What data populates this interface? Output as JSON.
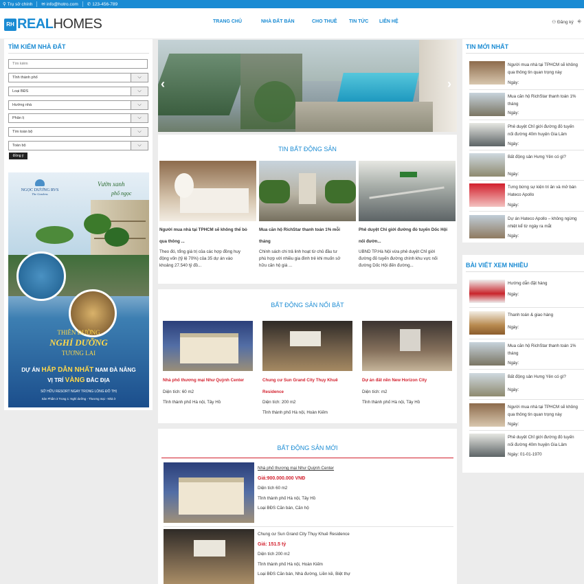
{
  "topbar": {
    "address": "Trụ sở chính",
    "email": "info@hotro.com",
    "phone": "123-456-789"
  },
  "header": {
    "logo_mark": "RH",
    "logo_word_1": "REAL",
    "logo_word_2": "HOMES",
    "nav": [
      "TRANG CHỦ",
      "NHÀ ĐẤT BÁN",
      "CHO THUÊ",
      "TIN TỨC",
      "LIÊN HỆ"
    ],
    "register": "Đăng ký"
  },
  "search": {
    "title": "TÌM KIẾM NHÀ ĐẤT",
    "placeholder": "Tìm kiếm",
    "selects": [
      "Tỉnh thành phố",
      "Loại BĐS",
      "Hướng nhà",
      "Phân lị",
      "Tìm toàn bộ",
      "Toàn bộ"
    ],
    "button": "Đồng ý"
  },
  "ad": {
    "brand": "NGỌC DƯƠNG RVS",
    "brand_sub": "The Gardens",
    "script": "Vườn xanh",
    "script_2": "phố ngọc",
    "line1": "THIÊN ĐƯỜNG",
    "line2": "NGHỈ DƯỠNG",
    "line3": "TƯƠNG LAI",
    "line4a": "DỰ ÁN",
    "line4b": "HẤP DẪN NHẤT",
    "line4c": "NAM ĐÀ NẴNG",
    "line5a": "VỊ TRÍ",
    "line5b": "VÀNG",
    "line5c": "ĐẮC ĐỊA",
    "line6": "SỞ HỮU RESORT NGAY TRONG LÒNG ĐÔ THỊ",
    "line7": "Sản Phẩm 3 Trong 1: Nghỉ dưỡng - Thương mại - Nhà ở"
  },
  "news_section": {
    "title": "TIN BẤT ĐỘNG SẢN",
    "items": [
      {
        "title_1": "Người mua nhà tại TPHCM sẽ không thể bỏ",
        "title_2": "qua thông ...",
        "desc_1": "Theo đó, tổng giá trị của các hợp đồng huy",
        "desc_2": "động vốn (tỷ lệ 70%) của 35 dự án vào",
        "desc_3": "khoảng 27.540 tỷ đồ..."
      },
      {
        "title_1": "Mua căn hộ RichStar thanh toán 1% mỗi",
        "title_2": "tháng",
        "desc_1": "Chính sách chi trả linh hoạt từ chủ đầu tư",
        "desc_2": "phù hợp với nhiều gia đình trẻ khi muốn sở",
        "desc_3": "hữu căn hộ giá ..."
      },
      {
        "title_1": "Phê duyệt Chỉ giới đường đỏ tuyến Dốc Hội",
        "title_2": "nối đườn...",
        "desc_1": "UBND TP.Hà Nội vừa phê duyệt Chỉ giới",
        "desc_2": "đường đỏ tuyến đường chính khu vực nối",
        "desc_3": "đường Dốc Hội đến đường..."
      }
    ]
  },
  "featured_section": {
    "title": "BẤT ĐỘNG SẢN NỔI BẬT",
    "items": [
      {
        "name_1": "Nhà phố thương mại Như Quỳnh Center",
        "name_2": "",
        "area": "Diện tích: 60 m2",
        "loc": "Tỉnh thành phố Hà nội, Tây Hồ"
      },
      {
        "name_1": "Chung cư Sun Grand City Thụy Khuê",
        "name_2": "Residence",
        "area": "Diện tích: 200 m2",
        "loc": "Tỉnh thành phố Hà nội, Hoàn Kiếm"
      },
      {
        "name_1": "Dự án đất nền New Horizon City",
        "name_2": "",
        "area": "Diện tích: m2",
        "loc": "Tỉnh thành phố Hà nội, Tây Hồ"
      }
    ]
  },
  "new_section": {
    "title": "BẤT ĐỘNG SẢN MỚI",
    "items": [
      {
        "name": "Nhà phố thương mại Như Quỳnh Center",
        "price": "Giá:900.000.000 VNĐ",
        "area": "Diện tích 60 m2",
        "loc": "Tỉnh thành phố Hà nội, Tây Hồ",
        "type": "Loại BĐS Căn bán, Căn hộ"
      },
      {
        "name": "Chung cư Sun Grand City Thụy Khuê Residence",
        "price": "Giá: 151.5 tỷ",
        "area": "Diện tích 200 m2",
        "loc": "Tỉnh thành phố Hà nội, Hoàn Kiếm",
        "type": "Loại BĐS Căn bán, Nhà đường, Liền kề, Biệt thự"
      }
    ]
  },
  "latest": {
    "title": "TIN MỚI NHẤT",
    "date_label": "Ngày:",
    "items": [
      {
        "t1": "Người mua nhà tại TPHCM sẽ không",
        "t2": "qua thông tin quan trọng này",
        "date": "Ngày:"
      },
      {
        "t1": "Mua căn hộ RichStar thanh toán 1%",
        "t2": "tháng",
        "date": "Ngày:"
      },
      {
        "t1": "Phê duyệt Chỉ giới đường đỏ tuyến",
        "t2": "nối đường 40m huyện Gia Lâm",
        "date": "Ngày:"
      },
      {
        "t1": "Bất động sản Hưng Yên có gì?",
        "t2": "",
        "date": "Ngày:"
      },
      {
        "t1": "Tưng bừng sự kiện tri ân và mở bán",
        "t2": "Hateco Apollo",
        "date": "Ngày:"
      },
      {
        "t1": "Dự án Hateco Apollo – không ngừng",
        "t2": "nhiệt kể từ ngày ra mắt",
        "date": "Ngày:"
      }
    ]
  },
  "popular": {
    "title": "BÀI VIẾT XEM NHIỀU",
    "items": [
      {
        "t1": "Hướng dẫn đặt hàng",
        "t2": "",
        "date": "Ngày:"
      },
      {
        "t1": "Thanh toán & giao hàng",
        "t2": "",
        "date": "Ngày:"
      },
      {
        "t1": "Mua căn hộ RichStar thanh toán 1%",
        "t2": "tháng",
        "date": "Ngày:"
      },
      {
        "t1": "Bất động sản Hưng Yên có gì?",
        "t2": "",
        "date": "Ngày:"
      },
      {
        "t1": "Người mua nhà tại TPHCM sẽ không",
        "t2": "qua thông tin quan trọng này",
        "date": "Ngày:"
      },
      {
        "t1": "Phê duyệt Chỉ giới đường đỏ tuyến",
        "t2": "nối đường 40m huyện Gia Lâm",
        "date": "Ngày: 01-01-1970"
      }
    ]
  },
  "colors": {
    "accent": "#1a8bd3",
    "price_red": "#d21f2c",
    "background": "#ececec"
  }
}
